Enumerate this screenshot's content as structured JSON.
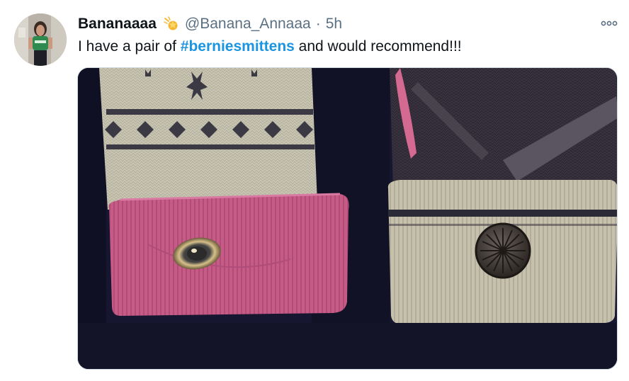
{
  "tweet": {
    "author": {
      "display_name": "Bananaaaa",
      "badge_icon": "shooting-star-icon",
      "handle": "@Banana_Annaaa",
      "separator": "·",
      "time": "5h"
    },
    "text": {
      "before": "I have a pair of ",
      "hashtag": "#berniesmittens",
      "after": " and would recommend!!!"
    },
    "media": {
      "kind": "photo",
      "content": "two knit mittens with folded cuffs and buttons"
    },
    "more_menu_icon": "more-options-icon"
  },
  "colors": {
    "primary_text": "#0f1419",
    "secondary_text": "#5b7083",
    "hashtag": "#1b95e0",
    "background": "#ffffff"
  }
}
